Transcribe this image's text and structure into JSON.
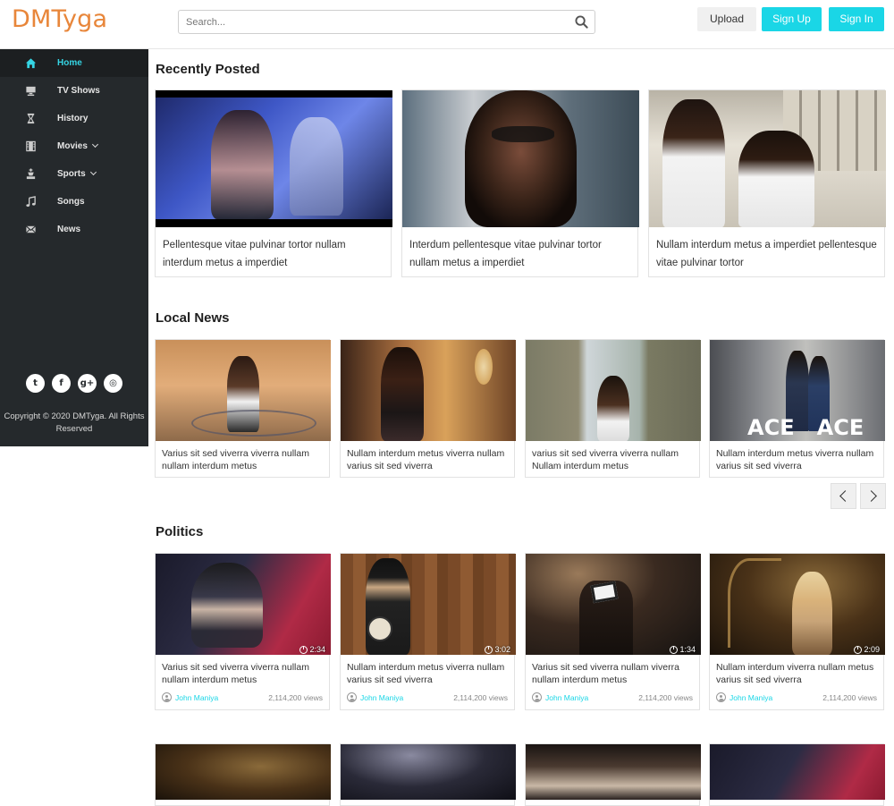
{
  "header": {
    "logo": "DMTyga",
    "search_placeholder": "Search...",
    "upload_label": "Upload",
    "signup_label": "Sign Up",
    "signin_label": "Sign In",
    "accent_color": "#1ad6e6",
    "logo_color": "#e8863a"
  },
  "sidebar": {
    "items": [
      {
        "label": "Home",
        "icon": "home-icon",
        "active": true
      },
      {
        "label": "TV Shows",
        "icon": "tv-icon"
      },
      {
        "label": "History",
        "icon": "hourglass-icon"
      },
      {
        "label": "Movies",
        "icon": "film-icon",
        "dropdown": true
      },
      {
        "label": "Sports",
        "icon": "chess-icon",
        "dropdown": true
      },
      {
        "label": "Songs",
        "icon": "music-icon"
      },
      {
        "label": "News",
        "icon": "envelope-icon"
      }
    ],
    "socials": [
      {
        "name": "twitter-icon",
        "glyph": "t"
      },
      {
        "name": "facebook-icon",
        "glyph": "f"
      },
      {
        "name": "google-plus-icon",
        "glyph": "g+"
      },
      {
        "name": "dribbble-icon",
        "glyph": "◎"
      }
    ],
    "copyright": "Copyright © 2020 DMTyga. All Rights Reserved"
  },
  "sections": {
    "recent": {
      "title": "Recently Posted",
      "cards": [
        {
          "title": "Pellentesque vitae pulvinar tortor nullam interdum metus a imperdiet"
        },
        {
          "title": "Interdum pellentesque vitae pulvinar tortor nullam metus a imperdiet"
        },
        {
          "title": "Nullam interdum metus a imperdiet pellentesque vitae pulvinar tortor"
        }
      ]
    },
    "local": {
      "title": "Local News",
      "cards": [
        {
          "title": "Varius sit sed viverra viverra nullam nullam interdum metus"
        },
        {
          "title": "Nullam interdum metus viverra nullam varius sit sed viverra"
        },
        {
          "title": "varius sit sed viverra viverra nullam Nullam interdum metus"
        },
        {
          "title": "Nullam interdum metus viverra nullam varius sit sed viverra",
          "overlay": "ACE   ACE"
        }
      ]
    },
    "politics": {
      "title": "Politics",
      "cards": [
        {
          "title": "Varius sit sed viverra viverra nullam nullam interdum metus",
          "duration": "2:34",
          "author": "John Maniya",
          "views": "2,114,200 views"
        },
        {
          "title": "Nullam interdum metus viverra nullam varius sit sed viverra",
          "duration": "3:02",
          "author": "John Maniya",
          "views": "2,114,200 views"
        },
        {
          "title": "Varius sit sed viverra nullam viverra nullam interdum metus",
          "duration": "1:34",
          "author": "John Maniya",
          "views": "2,114,200 views"
        },
        {
          "title": "Nullam interdum viverra nullam metus varius sit sed viverra",
          "duration": "2:09",
          "author": "John Maniya",
          "views": "2,114,200 views"
        }
      ]
    }
  }
}
